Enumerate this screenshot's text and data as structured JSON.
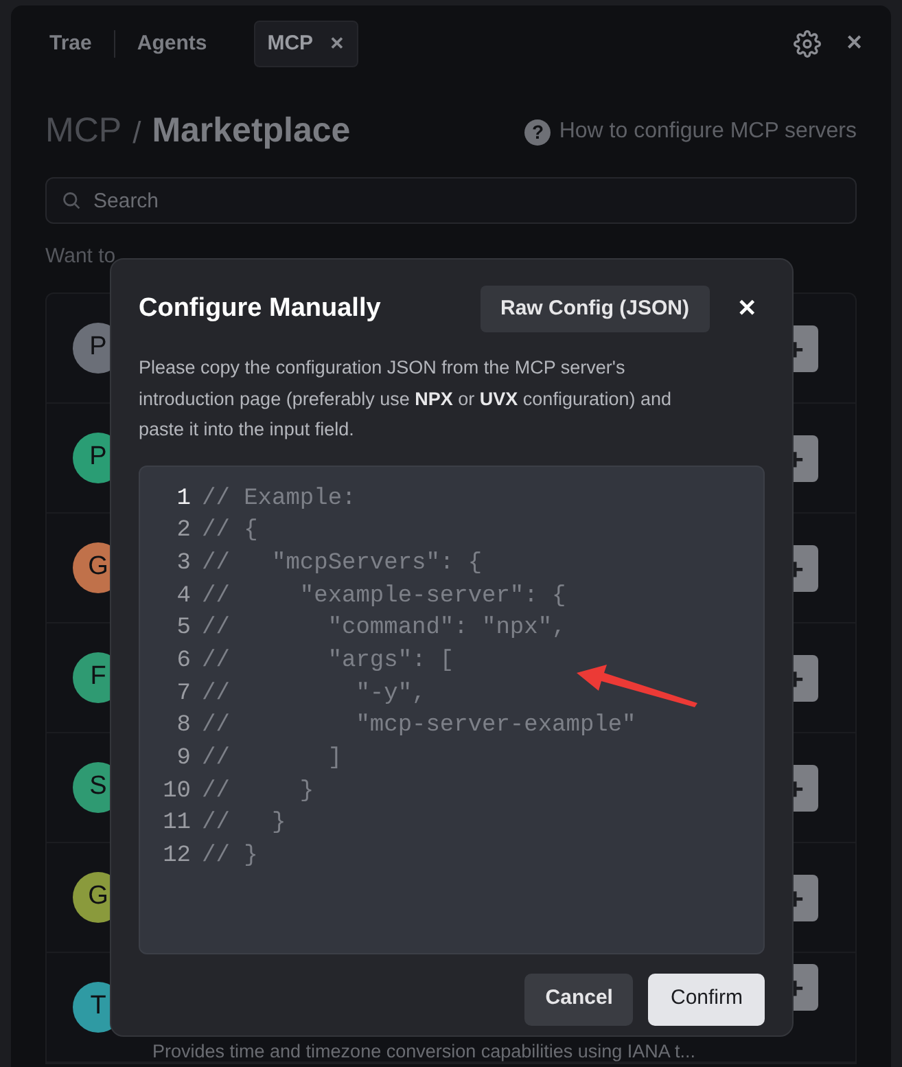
{
  "tabs": [
    {
      "label": "Trae",
      "selected": false
    },
    {
      "label": "Agents",
      "selected": false
    },
    {
      "label": "MCP",
      "selected": true,
      "close": "✕"
    }
  ],
  "window_close": "✕",
  "breadcrumb": {
    "parent": "MCP",
    "separator": "/",
    "current": "Marketplace"
  },
  "help_icon": "?",
  "help_link": "How to configure MCP servers",
  "search": {
    "placeholder": "Search"
  },
  "hint": "Want to",
  "servers": [
    {
      "initial": "P",
      "color": "#6b6f78",
      "add": "+"
    },
    {
      "initial": "P",
      "color": "#2a9d74",
      "add": "+"
    },
    {
      "initial": "G",
      "color": "#c0714a",
      "add": "+"
    },
    {
      "initial": "F",
      "color": "#2f9a72",
      "add": "+"
    },
    {
      "initial": "S",
      "color": "#2f9a72",
      "add": "+"
    },
    {
      "initial": "G",
      "color": "#8a9a3c",
      "add": "+"
    },
    {
      "initial": "T",
      "color": "#2f9aa3",
      "add": "+",
      "description": "Provides time and timezone conversion capabilities using IANA t..."
    }
  ],
  "dialog": {
    "title": "Configure Manually",
    "mode_button": "Raw Config (JSON)",
    "close": "✕",
    "description": "Please copy the configuration JSON from the MCP server's introduction page (preferably use **NPX** or **UVX** configuration) and paste it into the input field.",
    "code_lines": [
      {
        "number": "1",
        "text": "// Example:",
        "current": true
      },
      {
        "number": "2",
        "text": "// {",
        "current": false
      },
      {
        "number": "3",
        "text": "//   \"mcpServers\": {",
        "current": false
      },
      {
        "number": "4",
        "text": "//     \"example-server\": {",
        "current": false
      },
      {
        "number": "5",
        "text": "//       \"command\": \"npx\",",
        "current": false
      },
      {
        "number": "6",
        "text": "//       \"args\": [",
        "current": false
      },
      {
        "number": "7",
        "text": "//         \"-y\",",
        "current": false
      },
      {
        "number": "8",
        "text": "//         \"mcp-server-example\"",
        "current": false
      },
      {
        "number": "9",
        "text": "//       ]",
        "current": false
      },
      {
        "number": "10",
        "text": "//     }",
        "current": false
      },
      {
        "number": "11",
        "text": "//   }",
        "current": false
      },
      {
        "number": "12",
        "text": "// }",
        "current": false
      }
    ],
    "buttons": [
      {
        "label": "Cancel",
        "kind": "secondary"
      },
      {
        "label": "Confirm",
        "kind": "primary"
      }
    ]
  }
}
